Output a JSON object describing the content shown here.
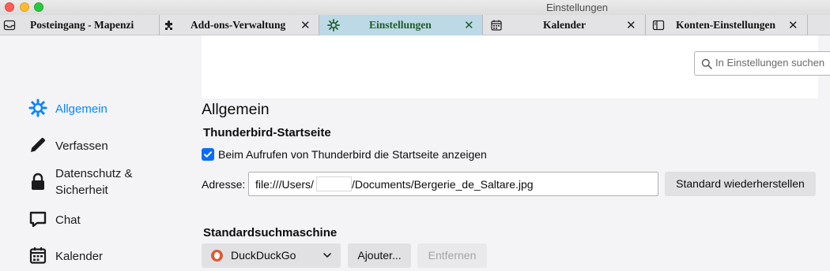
{
  "window": {
    "title": "Einstellungen"
  },
  "tabs": [
    {
      "label": "Posteingang - Mapenzi",
      "icon": "inbox-icon",
      "closable": false,
      "active": false
    },
    {
      "label": "Add-ons-Verwaltung",
      "icon": "puzzle-icon",
      "closable": true,
      "active": false
    },
    {
      "label": "Einstellungen",
      "icon": "gear-icon",
      "closable": true,
      "active": true
    },
    {
      "label": "Kalender",
      "icon": "calendar-icon",
      "closable": true,
      "active": false
    },
    {
      "label": "Konten-Einstellungen",
      "icon": "account-settings-icon",
      "closable": true,
      "active": false
    }
  ],
  "tab_close_glyph": "✕",
  "sidebar": {
    "items": [
      {
        "label": "Allgemein",
        "icon": "gear-icon",
        "selected": true
      },
      {
        "label": "Verfassen",
        "icon": "pencil-icon",
        "selected": false
      },
      {
        "label": "Datenschutz &",
        "label2": "Sicherheit",
        "icon": "lock-icon",
        "selected": false
      },
      {
        "label": "Chat",
        "icon": "chat-icon",
        "selected": false
      },
      {
        "label": "Kalender",
        "icon": "calendar-icon",
        "selected": false
      }
    ]
  },
  "search": {
    "placeholder": "In Einstellungen suchen",
    "value": ""
  },
  "main": {
    "title": "Allgemein",
    "startpage": {
      "heading": "Thunderbird-Startseite",
      "checkbox_label": "Beim Aufrufen von Thunderbird die Startseite anzeigen",
      "checkbox_checked": true,
      "address_label": "Adresse:",
      "address_prefix": "file:///Users/",
      "address_suffix": "/Documents/Bergerie_de_Saltare.jpg",
      "restore_button": "Standard wiederherstellen"
    },
    "search_engine": {
      "heading": "Standardsuchmaschine",
      "selected": "DuckDuckGo",
      "add_button": "Ajouter...",
      "remove_button": "Entfernen",
      "remove_disabled": true
    }
  },
  "colors": {
    "accent": "#0a84ff",
    "active_tab": "#bcd9e5",
    "active_tab_text": "#1f5b2b"
  }
}
